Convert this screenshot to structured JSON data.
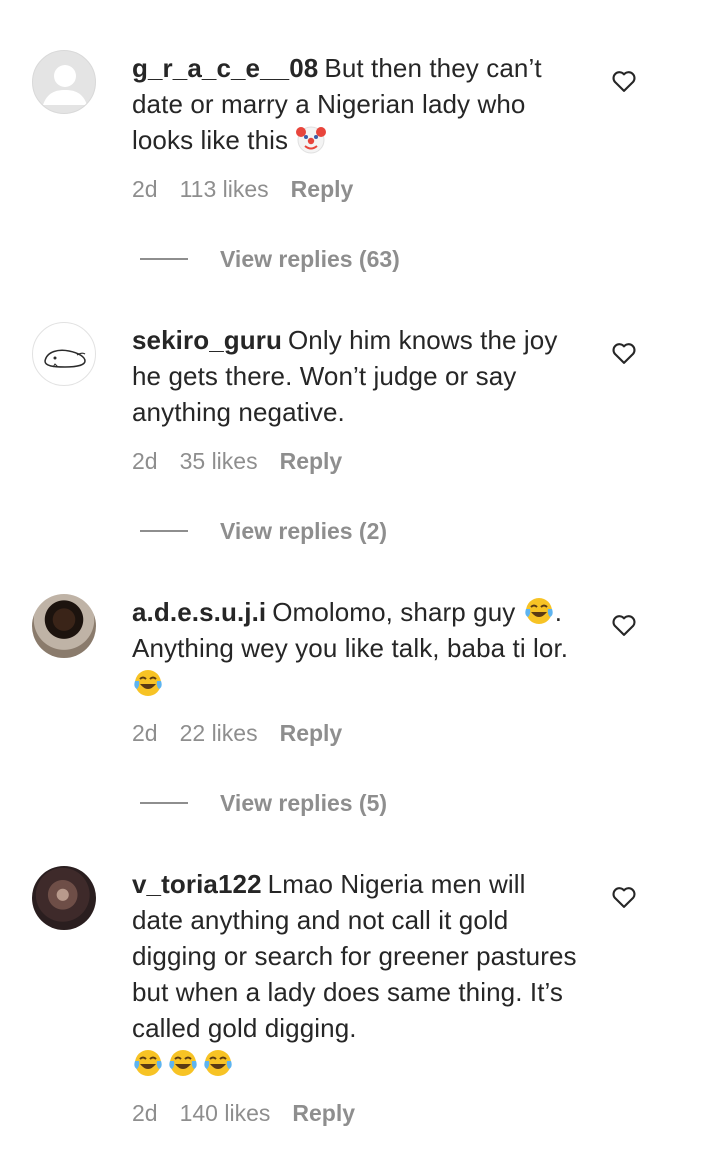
{
  "comments": [
    {
      "username": "g_r_a_c_e__08",
      "text": "But then they can’t date or marry a Nigerian lady who looks like this",
      "emojis": [
        "clown"
      ],
      "time": "2d",
      "likes": "113 likes",
      "reply": "Reply",
      "view_replies": "View replies (63)"
    },
    {
      "username": "sekiro_guru",
      "text": "Only him knows the joy he gets there. Won’t judge or say anything negative.",
      "emojis": [],
      "time": "2d",
      "likes": "35 likes",
      "reply": "Reply",
      "view_replies": "View replies (2)"
    },
    {
      "username": "a.d.e.s.u.j.i",
      "text_before": "Omolomo, sharp guy",
      "text_middle": ". Anything wey you like talk, baba ti lor.",
      "emojis": [
        "tears-of-joy",
        "tears-of-joy"
      ],
      "time": "2d",
      "likes": "22 likes",
      "reply": "Reply",
      "view_replies": "View replies (5)"
    },
    {
      "username": "v_toria122",
      "text": "Lmao Nigeria men will date anything and not call it gold digging or search for greener pastures but when a lady does same thing. It’s called gold digging.",
      "emojis": [
        "tears-of-joy",
        "tears-of-joy",
        "tears-of-joy"
      ],
      "time": "2d",
      "likes": "140 likes",
      "reply": "Reply"
    }
  ],
  "icons": {
    "like": "heart-outline-icon",
    "default_avatar": "default-avatar-icon"
  },
  "colors": {
    "text": "#262626",
    "secondary": "#8e8e8e"
  }
}
